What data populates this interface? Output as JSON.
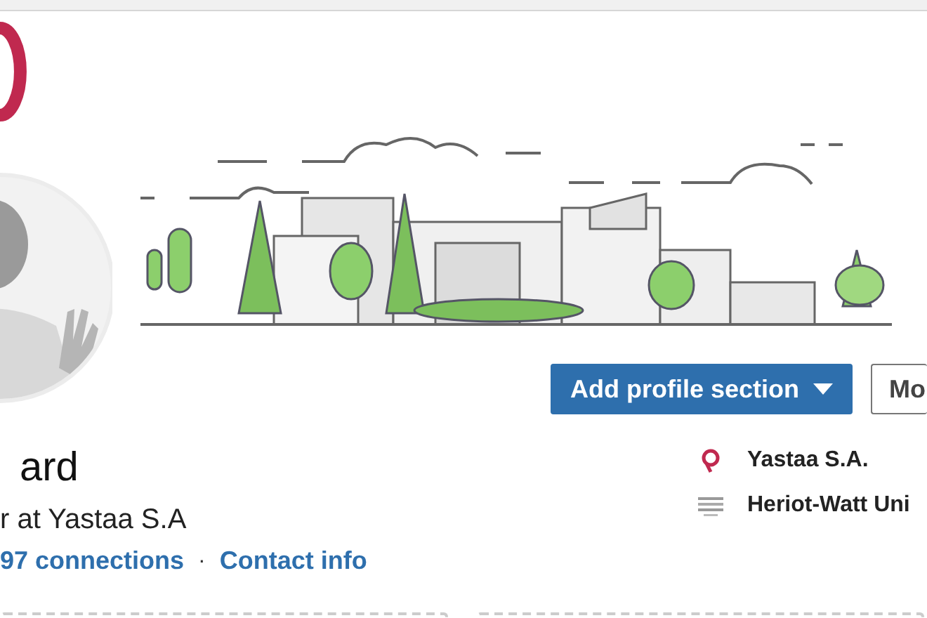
{
  "actions": [
    {
      "label": "Add profile section",
      "kind": "primary"
    },
    {
      "label": "Mo",
      "kind": "secondary"
    }
  ],
  "profile": {
    "name": "ard",
    "headline": "r at Yastaa S.A",
    "separator": "·",
    "links": [
      {
        "label": "97 connections"
      },
      {
        "label": "Contact info"
      }
    ]
  },
  "affiliations": [
    {
      "kind": "company",
      "label": "Yastaa S.A."
    },
    {
      "kind": "school",
      "label": "Heriot-Watt Uni"
    }
  ]
}
